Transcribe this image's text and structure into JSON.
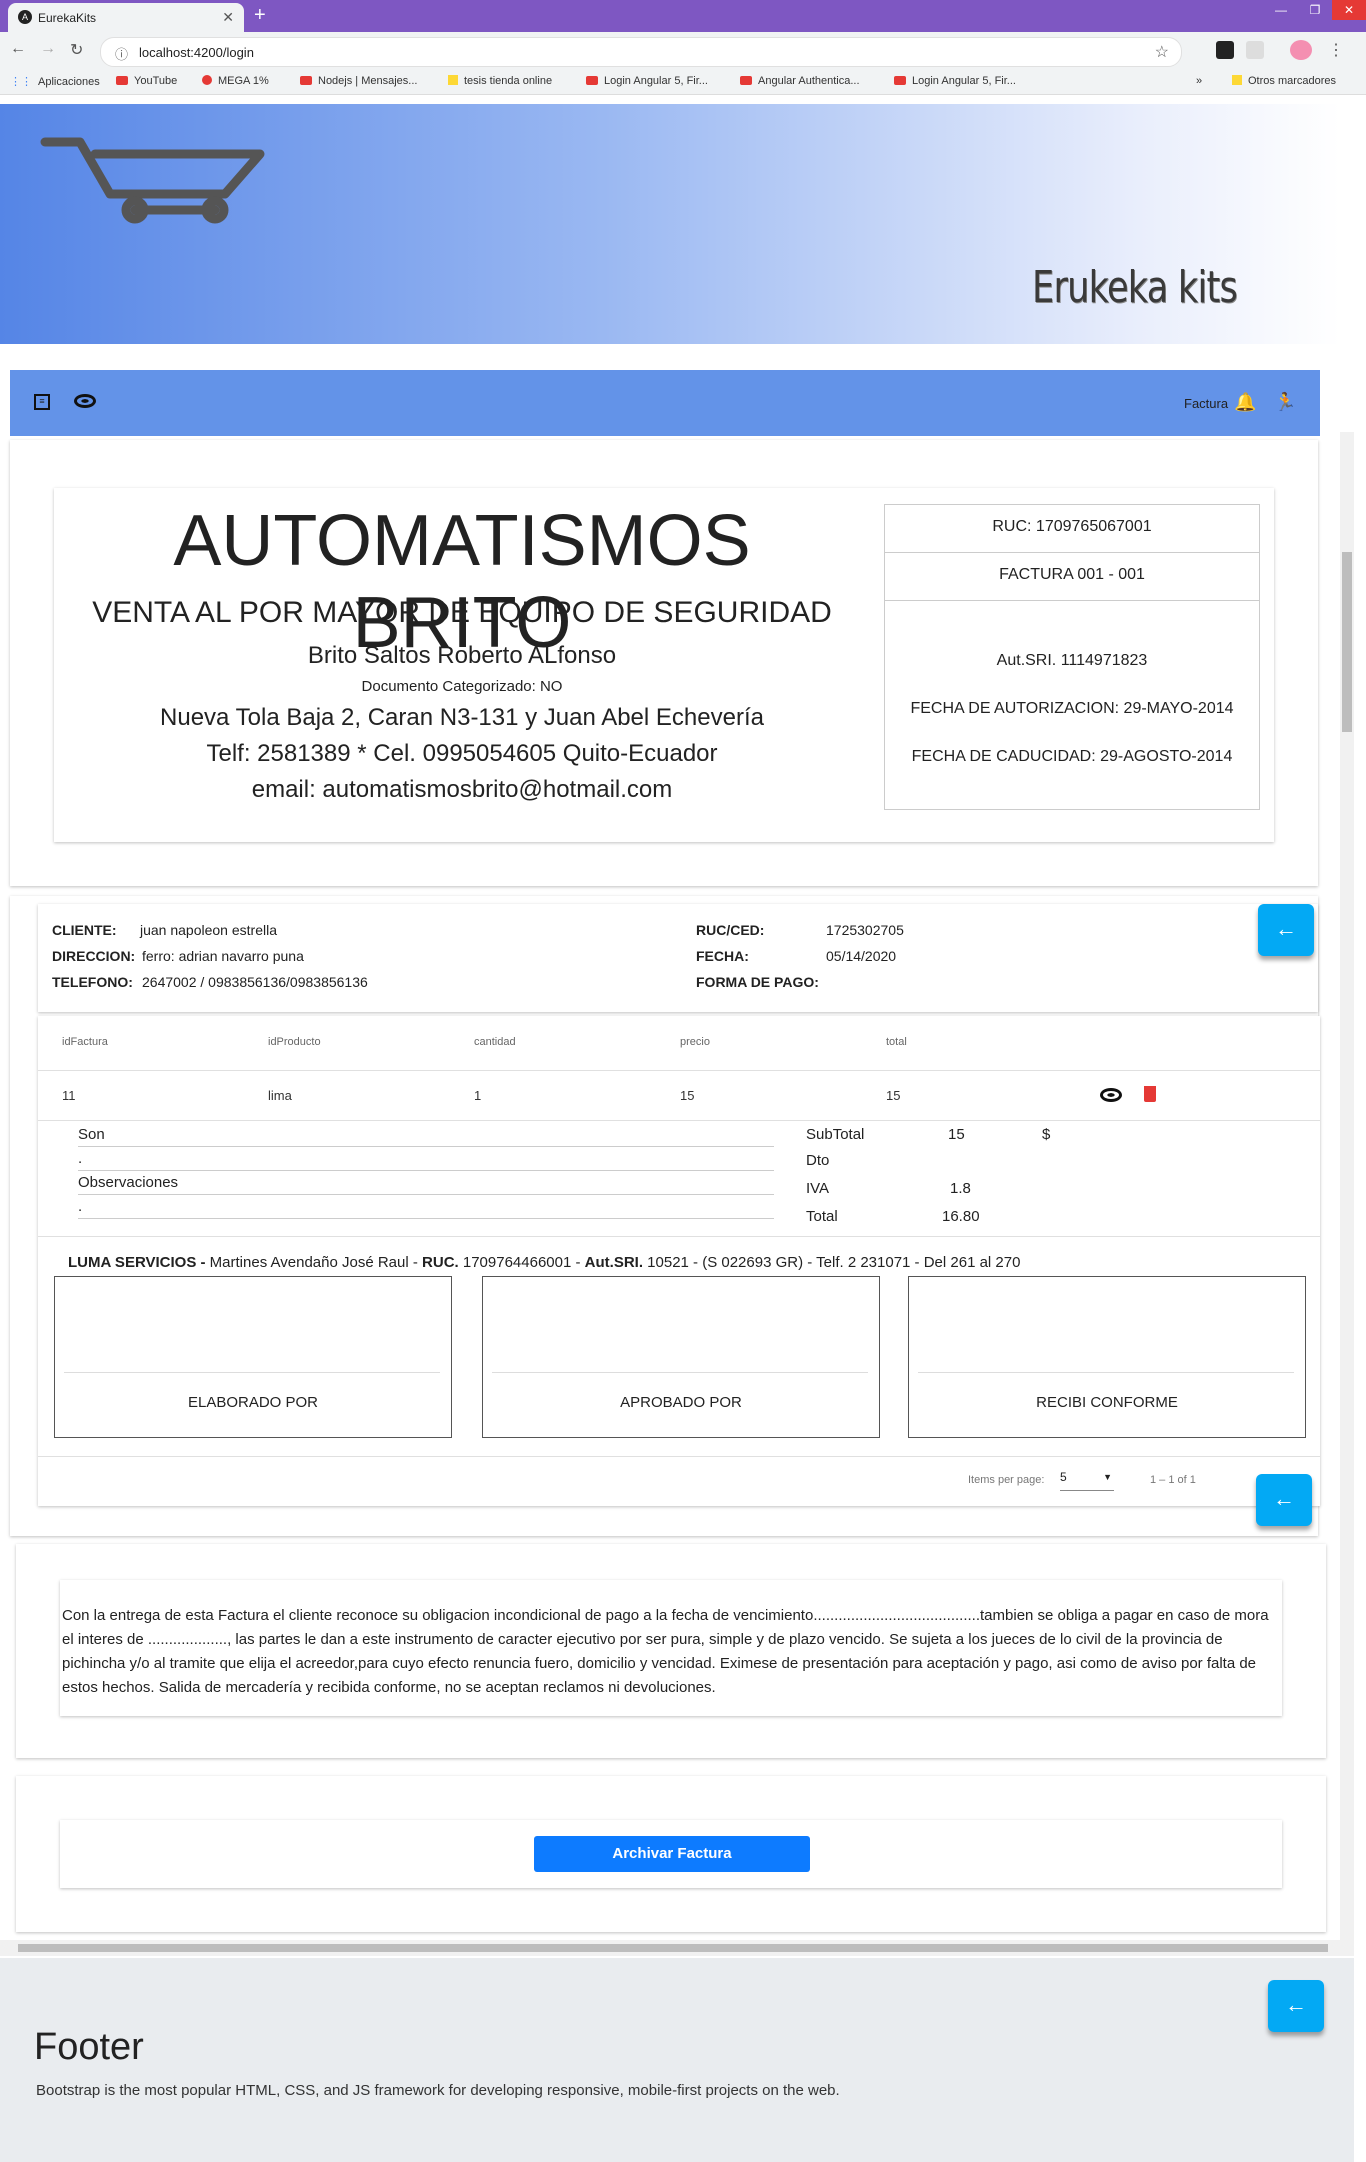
{
  "browser": {
    "tab_title": "EurekaKits",
    "url": "localhost:4200/login",
    "bookmarks": [
      "Aplicaciones",
      "YouTube",
      "MEGA 1%",
      "Nodejs | Mensajes...",
      "tesis tienda online",
      "Login Angular 5, Fir...",
      "Angular Authentica...",
      "Login Angular 5, Fir...",
      "»",
      "Otros marcadores"
    ]
  },
  "banner": {
    "brand": "Erukeka kits"
  },
  "appbar": {
    "menu_label": "Factura"
  },
  "company": {
    "name": "AUTOMATISMOS BRITO",
    "activity": "VENTA AL POR MAYOR DE EQUIPO DE SEGURIDAD",
    "owner": "Brito Saltos Roberto ALfonso",
    "doc": "Documento Categorizado: NO",
    "address": "Nueva Tola Baja 2, Caran N3-131 y Juan Abel Echevería",
    "phone": "Telf: 2581389 * Cel. 0995054605 Quito-Ecuador",
    "email": "email: automatismosbrito@hotmail.com"
  },
  "sri": {
    "ruc": "RUC: 1709765067001",
    "factura": "FACTURA 001 - 001",
    "aut": "Aut.SRI. 1114971823",
    "fecha_aut": "FECHA DE AUTORIZACION: 29-MAYO-2014",
    "fecha_cad": "FECHA DE CADUCIDAD: 29-AGOSTO-2014"
  },
  "client": {
    "cliente_label": "CLIENTE:",
    "cliente": "juan napoleon estrella",
    "direccion_label": "DIRECCION:",
    "direccion": "ferro: adrian navarro puna",
    "telefono_label": "TELEFONO:",
    "telefono": "2647002 / 0983856136/0983856136",
    "ruc_label": "RUC/CED:",
    "ruc": "1725302705",
    "fecha_label": "FECHA:",
    "fecha": "05/14/2020",
    "pago_label": "FORMA DE PAGO:"
  },
  "table": {
    "headers": [
      "idFactura",
      "idProducto",
      "cantidad",
      "precio",
      "total"
    ],
    "rows": [
      [
        "11",
        "lima",
        "1",
        "15",
        "15"
      ]
    ]
  },
  "summary": {
    "son_label": "Son",
    "son_value": ".",
    "obs_label": "Observaciones",
    "obs_value": ".",
    "subtotal_label": "SubTotal",
    "subtotal": "15",
    "currency": "$",
    "dto_label": "Dto",
    "iva_label": "IVA",
    "iva": "1.8",
    "total_label": "Total",
    "total": "16.80"
  },
  "printer": {
    "b1": "LUMA SERVICIOS -",
    "t1": " Martines Avendaño José Raul - ",
    "b2": "RUC.",
    "t2": " 1709764466001 - ",
    "b3": "Aut.SRI.",
    "t3": " 10521 - (S 022693 GR) - Telf. 2 231071 - Del 261 al 270"
  },
  "signatures": [
    "ELABORADO POR",
    "APROBADO POR",
    "RECIBI CONFORME"
  ],
  "paginator": {
    "items_label": "Items per page:",
    "page_size": "5",
    "range": "1 – 1 of 1"
  },
  "terms": "Con la entrega de esta Factura el cliente reconoce su obligacion incondicional de pago a la fecha de vencimiento........................................tambien se obliga a pagar en caso de mora el interes de ..................., las partes le dan a este instrumento de caracter ejecutivo por ser pura, simple y de plazo vencido. Se sujeta a los jueces de lo civil de la provincia de pichincha y/o al tramite que elija el acreedor,para cuyo efecto renuncia fuero, domicilio y vencidad. Eximese de presentación para aceptación y pago, asi como de aviso por falta de estos hechos. Salida de mercadería y recibida conforme, no se aceptan reclamos ni devoluciones.",
  "archive_button": "Archivar Factura",
  "footer": {
    "title": "Footer",
    "text": "Bootstrap is the most popular HTML, CSS, and JS framework for developing responsive, mobile-first projects on the web."
  },
  "colors": {
    "chrome": "#7e57c2",
    "appbar": "#6393e8",
    "fab": "#03a9f4",
    "primary_button": "#0d7bff",
    "delete": "#e53935"
  }
}
